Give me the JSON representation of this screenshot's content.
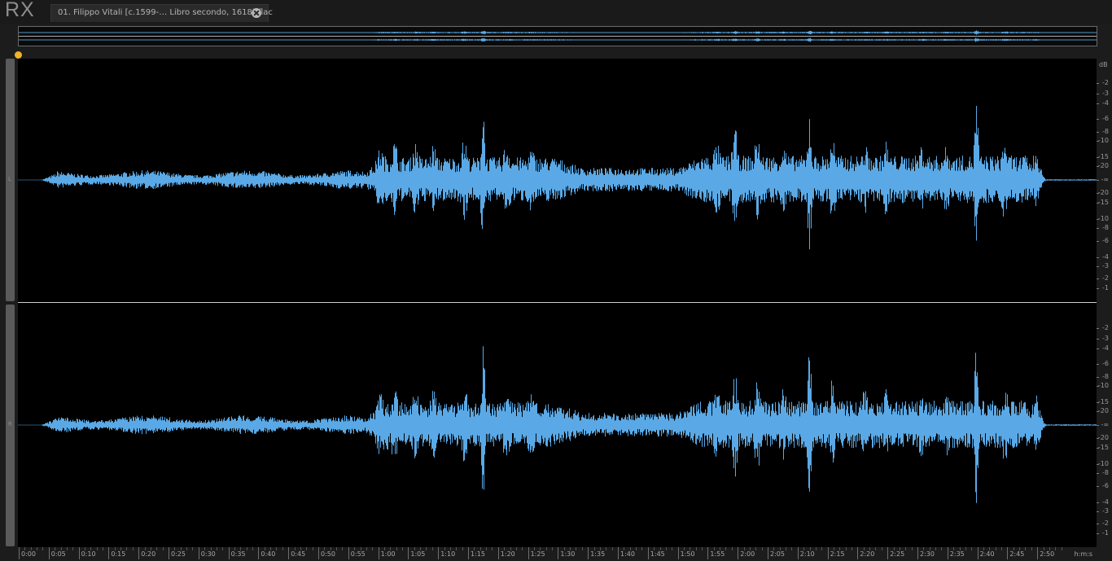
{
  "app": {
    "logo_text": "RX"
  },
  "tab": {
    "label": "01. Filippo Vitali [c.1599-… Libro secondo, 1618).flac"
  },
  "channels": {
    "left": "L",
    "right": "R"
  },
  "colors": {
    "waveform": "#5aa9e6",
    "playhead": "#f0b22a",
    "background": "#000000"
  },
  "db_scale": {
    "unit": "dB",
    "labels": [
      "-2",
      "-3",
      "-4",
      "-6",
      "-8",
      "-10",
      "-15",
      "-20",
      "-∞",
      "-20",
      "-15",
      "-10",
      "-8",
      "-6",
      "-4",
      "-3",
      "-2",
      "-1"
    ]
  },
  "timeline": {
    "unit_label": "h:m:s",
    "labels": [
      "0:00",
      "0:05",
      "0:10",
      "0:15",
      "0:20",
      "0:25",
      "0:30",
      "0:35",
      "0:40",
      "0:45",
      "0:50",
      "0:55",
      "1:00",
      "1:05",
      "1:10",
      "1:15",
      "1:20",
      "1:25",
      "1:30",
      "1:35",
      "1:40",
      "1:45",
      "1:50",
      "1:55",
      "2:00",
      "2:05",
      "2:10",
      "2:15",
      "2:20",
      "2:25",
      "2:30",
      "2:35",
      "2:40",
      "2:45",
      "2:50"
    ]
  }
}
